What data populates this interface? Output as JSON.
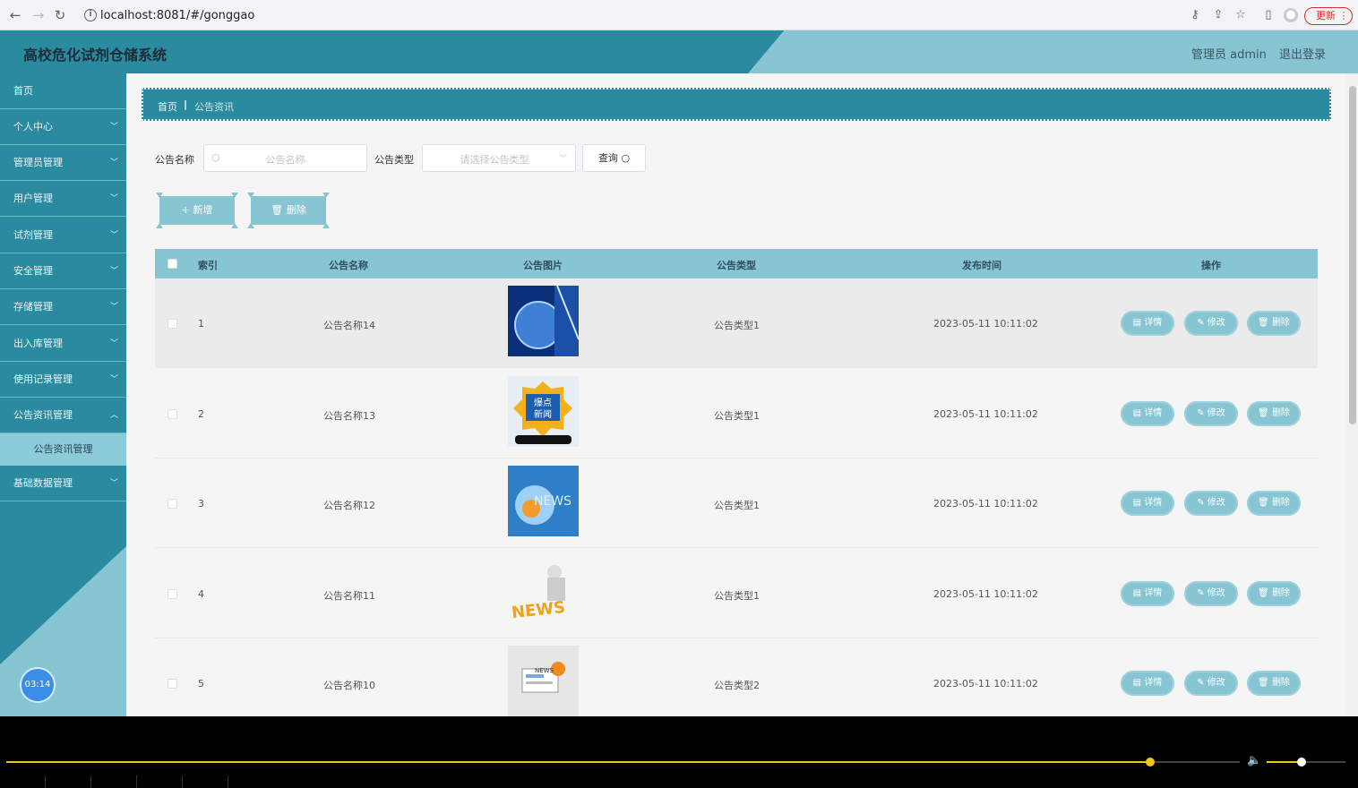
{
  "browser": {
    "url": "localhost:8081/#/gonggao",
    "update_label": "更新"
  },
  "header": {
    "title": "高校危化试剂仓储系统",
    "user": "管理员 admin",
    "logout": "退出登录"
  },
  "sidebar": {
    "items": [
      {
        "label": "首页",
        "has_chevron": false
      },
      {
        "label": "个人中心",
        "has_chevron": true
      },
      {
        "label": "管理员管理",
        "has_chevron": true
      },
      {
        "label": "用户管理",
        "has_chevron": true
      },
      {
        "label": "试剂管理",
        "has_chevron": true
      },
      {
        "label": "安全管理",
        "has_chevron": true
      },
      {
        "label": "存储管理",
        "has_chevron": true
      },
      {
        "label": "出入库管理",
        "has_chevron": true
      },
      {
        "label": "使用记录管理",
        "has_chevron": true
      },
      {
        "label": "公告资讯管理",
        "has_chevron": true,
        "expanded": true
      }
    ],
    "subitem": "公告资讯管理",
    "after_item": "基础数据管理",
    "timer": "03:14"
  },
  "breadcrumb": {
    "home": "首页",
    "separator": "|",
    "current": "公告资讯"
  },
  "filters": {
    "name_label": "公告名称",
    "name_placeholder": "公告名称",
    "type_label": "公告类型",
    "type_placeholder": "请选择公告类型",
    "query_label": "查询"
  },
  "actions": {
    "add_label": "新增",
    "delete_label": "删除"
  },
  "table": {
    "columns": [
      "索引",
      "公告名称",
      "公告图片",
      "公告类型",
      "发布时间",
      "操作"
    ],
    "rows": [
      {
        "index": "1",
        "name": "公告名称14",
        "type": "公告类型1",
        "time": "2023-05-11 10:11:02",
        "image": "globe-news"
      },
      {
        "index": "2",
        "name": "公告名称13",
        "type": "公告类型1",
        "time": "2023-05-11 10:11:02",
        "image": "hot-news-phone"
      },
      {
        "index": "3",
        "name": "公告名称12",
        "type": "公告类型1",
        "time": "2023-05-11 10:11:02",
        "image": "news-blue"
      },
      {
        "index": "4",
        "name": "公告名称11",
        "type": "公告类型1",
        "time": "2023-05-11 10:11:02",
        "image": "news-reader"
      },
      {
        "index": "5",
        "name": "公告名称10",
        "type": "公告类型2",
        "time": "2023-05-11 10:11:02",
        "image": "news-paper"
      }
    ],
    "op_labels": {
      "detail": "详情",
      "edit": "修改",
      "delete": "删除"
    }
  },
  "player": {
    "progress": 0.843,
    "volume": 0.45
  },
  "colors": {
    "primary": "#2a8aa0",
    "accent": "#88c5d3",
    "progress": "#f0c419"
  }
}
